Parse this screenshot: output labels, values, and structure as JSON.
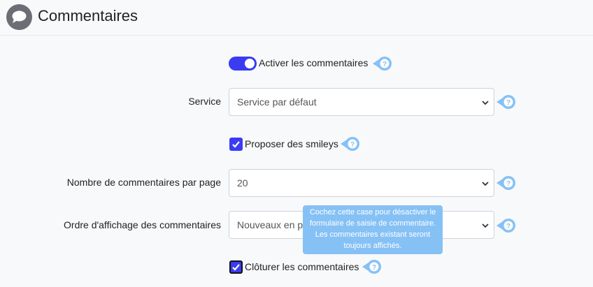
{
  "header": {
    "title": "Commentaires",
    "icon": "comment-icon"
  },
  "form": {
    "enable_comments": {
      "label": "Activer les commentaires",
      "checked": true
    },
    "service": {
      "label": "Service",
      "value": "Service par défaut"
    },
    "smileys": {
      "label": "Proposer des smileys",
      "checked": true
    },
    "per_page": {
      "label": "Nombre de commentaires par page",
      "value": "20"
    },
    "order": {
      "label": "Ordre d'affichage des commentaires",
      "value": "Nouveaux en premier"
    },
    "close_comments": {
      "label": "Clôturer les commentaires",
      "checked": true
    }
  },
  "tooltip": {
    "text": "Cochez cette case pour désactiver le formulaire de saisie de commentaire. Les commentaires existant seront toujours affichés."
  },
  "colors": {
    "accent": "#3b3bf4",
    "help": "#86c1f5"
  }
}
